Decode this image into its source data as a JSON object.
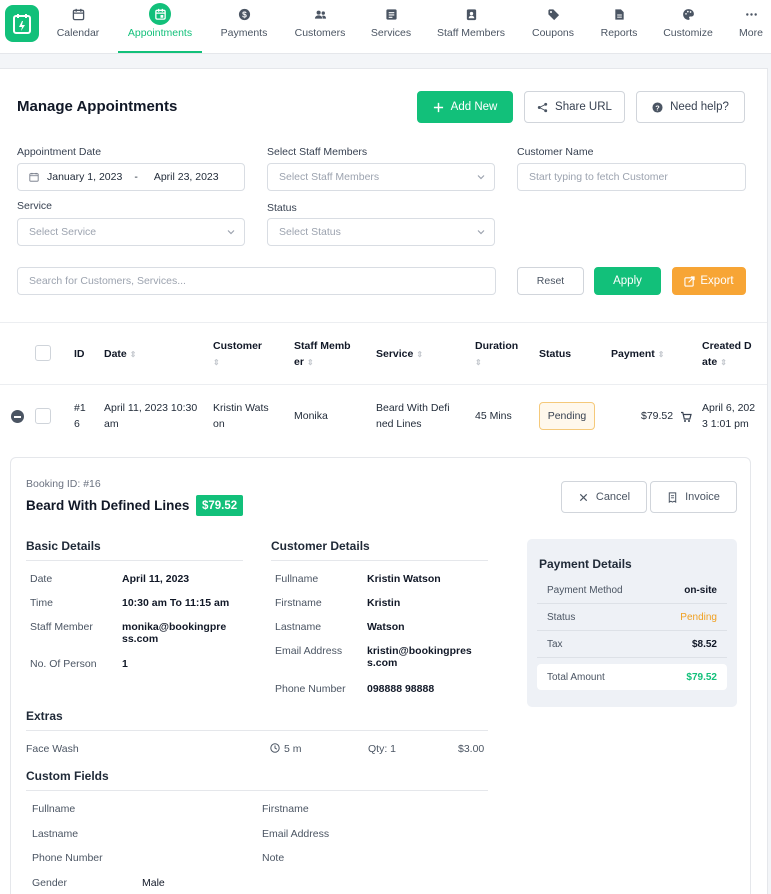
{
  "nav": {
    "items": [
      {
        "label": "Calendar",
        "icon": "calendar-icon"
      },
      {
        "label": "Appointments",
        "icon": "appointments-icon"
      },
      {
        "label": "Payments",
        "icon": "dollar-icon"
      },
      {
        "label": "Customers",
        "icon": "users-icon"
      },
      {
        "label": "Services",
        "icon": "services-icon"
      },
      {
        "label": "Staff Members",
        "icon": "staff-icon"
      },
      {
        "label": "Coupons",
        "icon": "tag-icon"
      },
      {
        "label": "Reports",
        "icon": "report-icon"
      },
      {
        "label": "Customize",
        "icon": "palette-icon"
      },
      {
        "label": "More",
        "icon": "more-icon"
      }
    ],
    "active": "Appointments"
  },
  "page": {
    "title": "Manage Appointments",
    "add_new": "Add New",
    "share_url": "Share URL",
    "need_help": "Need help?"
  },
  "filters": {
    "date_label": "Appointment Date",
    "date_from": "January 1, 2023",
    "date_sep": "-",
    "date_to": "April 23, 2023",
    "staff_label": "Select Staff Members",
    "staff_placeholder": "Select Staff Members",
    "customer_label": "Customer Name",
    "customer_placeholder": "Start typing to fetch Customer",
    "service_label": "Service",
    "service_placeholder": "Select Service",
    "status_label": "Status",
    "status_placeholder": "Select Status",
    "search_placeholder": "Search for Customers, Services...",
    "reset": "Reset",
    "apply": "Apply",
    "export": "Export"
  },
  "table": {
    "headers": {
      "id": "ID",
      "date": "Date",
      "customer": "Customer",
      "staff_1": "Staff Memb",
      "staff_2": "er",
      "service": "Service",
      "duration": "Duration",
      "status": "Status",
      "payment": "Payment",
      "created_1": "Created D",
      "created_2": "ate"
    },
    "row": {
      "id_1": "#1",
      "id_2": "6",
      "date_1": "April 11, 2023 10:30",
      "date_2": "am",
      "customer_1": "Kristin Wats",
      "customer_2": "on",
      "staff": "Monika",
      "service_1": "Beard With Defi",
      "service_2": "ned Lines",
      "duration": "45 Mins",
      "status": "Pending",
      "payment": "$79.52",
      "created_1": "April 6, 202",
      "created_2": "3 1:01 pm"
    }
  },
  "booking": {
    "id_label": "Booking ID: #16",
    "service": "Beard With Defined Lines",
    "price": "$79.52",
    "cancel": "Cancel",
    "invoice": "Invoice",
    "basic_title": "Basic Details",
    "basic": [
      {
        "k": "Date",
        "v": "April 11, 2023"
      },
      {
        "k": "Time",
        "v": "10:30 am To 11:15 am"
      },
      {
        "k": "Staff Member",
        "v": "monika@bookingpre ss.com"
      },
      {
        "k": "No. Of Person",
        "v": "1"
      }
    ],
    "customer_title": "Customer Details",
    "customer": [
      {
        "k": "Fullname",
        "v": "Kristin Watson"
      },
      {
        "k": "Firstname",
        "v": "Kristin"
      },
      {
        "k": "Lastname",
        "v": "Watson"
      },
      {
        "k": "Email Address",
        "v": "kristin@bookingpres s.com"
      },
      {
        "k": "Phone Number",
        "v": "098888 98888"
      }
    ],
    "payment_title": "Payment Details",
    "payment": [
      {
        "k": "Payment Method",
        "v": "on-site"
      },
      {
        "k": "Status",
        "v": "Pending"
      },
      {
        "k": "Tax",
        "v": "$8.52"
      },
      {
        "k": "Total Amount",
        "v": "$79.52"
      }
    ],
    "extras_title": "Extras",
    "extras": {
      "name": "Face Wash",
      "duration": "5 m",
      "qty": "Qty: 1",
      "price": "$3.00"
    },
    "custom_title": "Custom Fields",
    "custom": {
      "fullname": "Fullname",
      "firstname": "Firstname",
      "lastname": "Lastname",
      "email": "Email Address",
      "phone": "Phone Number",
      "note": "Note",
      "gender": "Gender",
      "gender_value": "Male"
    }
  },
  "colors": {
    "accent": "#12c07a",
    "warning": "#f7a535",
    "pending": "#f0a020"
  }
}
